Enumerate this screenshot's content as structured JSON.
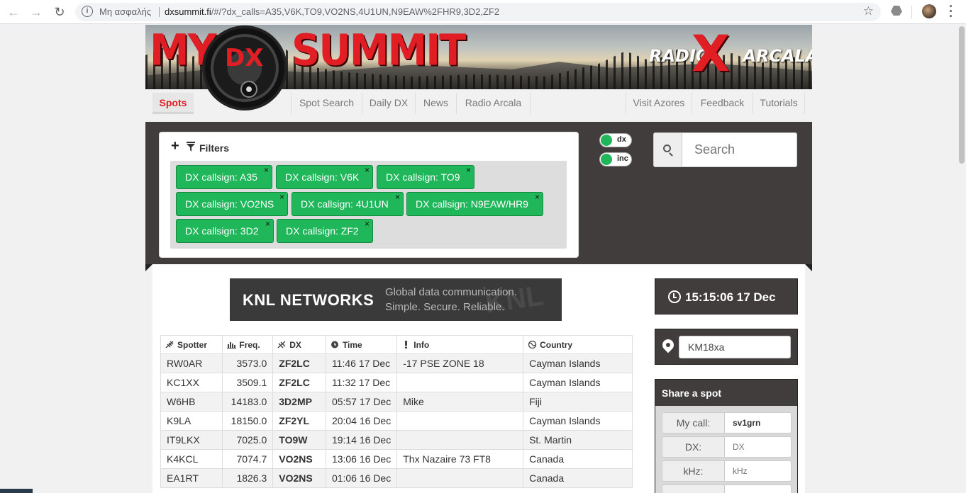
{
  "browser": {
    "secure_label": "Μη ασφαλής",
    "url_host": "dxsummit.fi",
    "url_path": "/#/?dx_calls=A35,V6K,TO9,VO2NS,4U1UN,N9EAW%2FHR9,3D2,ZF2"
  },
  "banner": {
    "logo_my": "MY",
    "logo_dx": "DX",
    "logo_summit": "SUMMIT",
    "radio_left": "RADIO",
    "radio_x": "X",
    "radio_right": "ARCALA"
  },
  "nav": {
    "spots": "Spots",
    "spot_search": "Spot Search",
    "daily_dx": "Daily DX",
    "news": "News",
    "radio_arcala": "Radio Arcala",
    "visit_azores": "Visit Azores",
    "feedback": "Feedback",
    "tutorials": "Tutorials"
  },
  "filters": {
    "title": "Filters",
    "chips": [
      "DX callsign: A35",
      "DX callsign: V6K",
      "DX callsign: TO9",
      "DX callsign: VO2NS",
      "DX callsign: 4U1UN",
      "DX callsign: N9EAW/HR9",
      "DX callsign: 3D2",
      "DX callsign: ZF2"
    ],
    "close": "×"
  },
  "toggles": {
    "dx": "dx",
    "inc": "inc"
  },
  "search": {
    "placeholder": "Search"
  },
  "ad": {
    "brand": "KNL NETWORKS",
    "tagline1": "Global data communication.",
    "tagline2": "Simple. Secure. Reliable.",
    "watermark": "KNL"
  },
  "table": {
    "headers": [
      "Spotter",
      "Freq.",
      "DX",
      "Time",
      "Info",
      "Country"
    ],
    "rows": [
      [
        "RW0AR",
        "3573.0",
        "ZF2LC",
        "11:46 17 Dec",
        "-17 PSE ZONE 18",
        "Cayman Islands"
      ],
      [
        "KC1XX",
        "3509.1",
        "ZF2LC",
        "11:32 17 Dec",
        "",
        "Cayman Islands"
      ],
      [
        "W6HB",
        "14183.0",
        "3D2MP",
        "05:57 17 Dec",
        "Mike",
        "Fiji"
      ],
      [
        "K9LA",
        "18150.0",
        "ZF2YL",
        "20:04 16 Dec",
        "",
        "Cayman Islands"
      ],
      [
        "IT9LKX",
        "7025.0",
        "TO9W",
        "19:14 16 Dec",
        "",
        "St. Martin"
      ],
      [
        "K4KCL",
        "7074.7",
        "VO2NS",
        "13:06 16 Dec",
        "Thx Nazaire 73 FT8",
        "Canada"
      ],
      [
        "EA1RT",
        "1826.3",
        "VO2NS",
        "01:06 16 Dec",
        "",
        "Canada"
      ]
    ]
  },
  "clock": {
    "time": "15:15:06 17 Dec"
  },
  "locator": {
    "value": "KM18xa"
  },
  "share": {
    "title": "Share a spot",
    "my_call_label": "My call:",
    "my_call_value": "sv1grn",
    "dx_label": "DX:",
    "dx_placeholder": "DX",
    "khz_label": "kHz:",
    "khz_placeholder": "kHz"
  },
  "colors": {
    "accent_red": "#e01e24",
    "chip_green": "#1fb75a",
    "panel_dark": "#423d3d"
  }
}
